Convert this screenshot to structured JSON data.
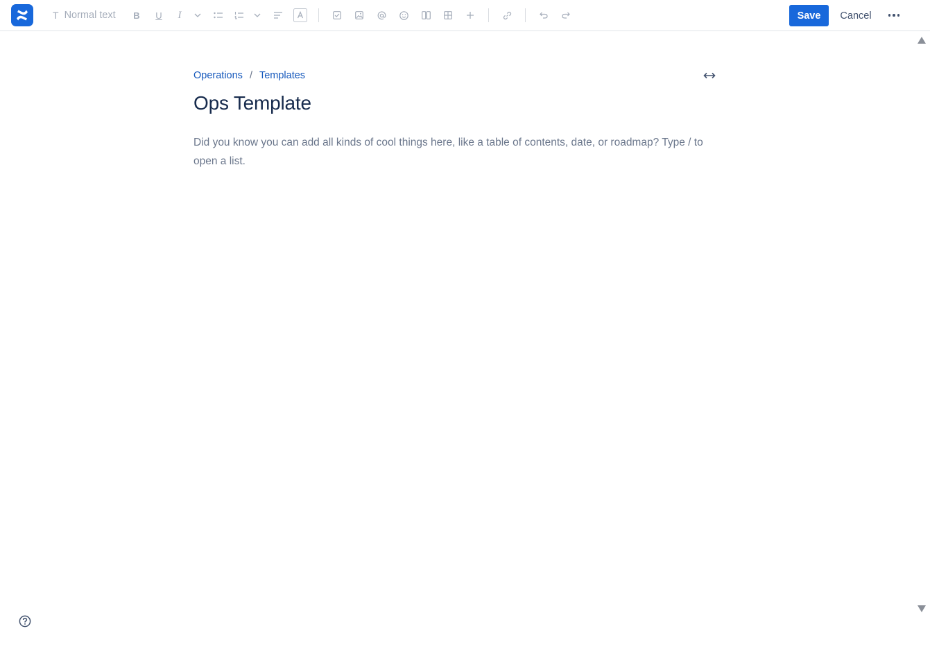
{
  "toolbar": {
    "text_style": "Normal text",
    "save_label": "Save",
    "cancel_label": "Cancel",
    "icons": [
      "text-icon",
      "bold-icon",
      "underline-icon",
      "italic-icon",
      "chevron-down-icon",
      "bullet-list-icon",
      "numbered-list-icon",
      "chevron-down-icon",
      "align-icon",
      "text-color-icon",
      "task-icon",
      "image-icon",
      "mention-icon",
      "emoji-icon",
      "layout-icon",
      "table-icon",
      "plus-icon",
      "link-icon",
      "undo-icon",
      "redo-icon",
      "more-icon"
    ]
  },
  "breadcrumb": {
    "items": [
      "Operations",
      "Templates"
    ],
    "separator": "/"
  },
  "page": {
    "title": "Ops Template",
    "placeholder": "Did you know you can add all kinds of cool things here, like a table of contents, date, or roadmap? Type / to open a list."
  },
  "colors": {
    "brand": "#1868db",
    "link": "#1558bc",
    "text": "#172b4d",
    "muted": "#a5adba"
  }
}
